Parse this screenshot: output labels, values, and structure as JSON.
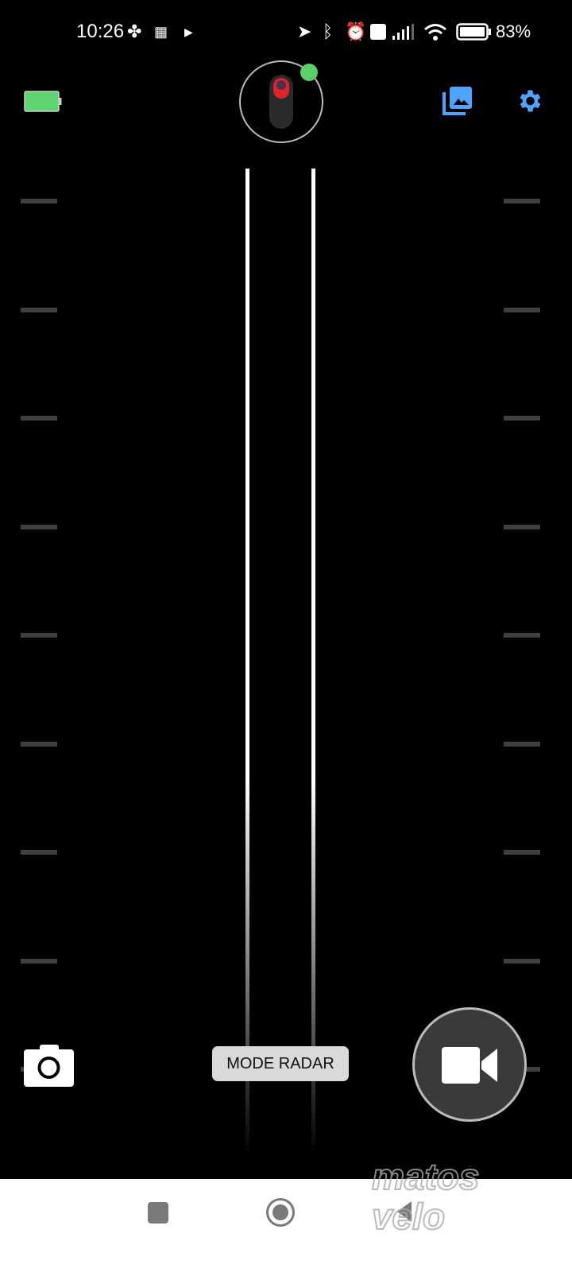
{
  "status_bar": {
    "time": "10:26",
    "battery_percent": "83%",
    "icons": [
      "pinwheel-icon",
      "qr-icon",
      "play-icon",
      "location-icon",
      "bluetooth-icon",
      "alarm-icon",
      "volte-icon",
      "signal-icon",
      "wifi-icon",
      "battery-icon"
    ]
  },
  "header": {
    "device_battery_level": 1.0,
    "device_connected": true,
    "colors": {
      "accent": "#4da3ff",
      "connected": "#5bd06a",
      "battery": "#5fd56f"
    }
  },
  "radar": {
    "tick_count": 9
  },
  "controls": {
    "mode_label": "MODE RADAR"
  },
  "watermark": "matos velo"
}
